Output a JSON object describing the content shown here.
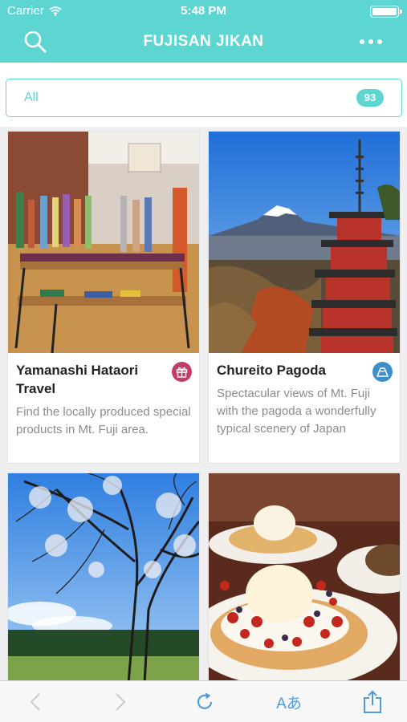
{
  "status": {
    "carrier": "Carrier",
    "time": "5:48 PM"
  },
  "nav": {
    "title": "FUJISAN JIKAN"
  },
  "filter": {
    "label": "All",
    "count": "93"
  },
  "cards": [
    {
      "title": "Yamanashi Hataori Travel",
      "desc": "Find the locally produced special products in Mt. Fuji area.",
      "badge_icon": "gift-icon",
      "badge_color": "#c03d6b"
    },
    {
      "title": "Chureito Pagoda",
      "desc": "Spectacular views of Mt. Fuji with the pagoda a wonderfully typical scenery of Japan",
      "badge_icon": "mount-fuji-icon",
      "badge_color": "#3e8fc7"
    },
    {
      "title": "",
      "desc": ""
    },
    {
      "title": "",
      "desc": ""
    }
  ],
  "toolbar": {
    "font_label": "Aあ"
  },
  "colors": {
    "accent": "#5dd6d2",
    "toolbar_icon": "#4f9bd9"
  }
}
